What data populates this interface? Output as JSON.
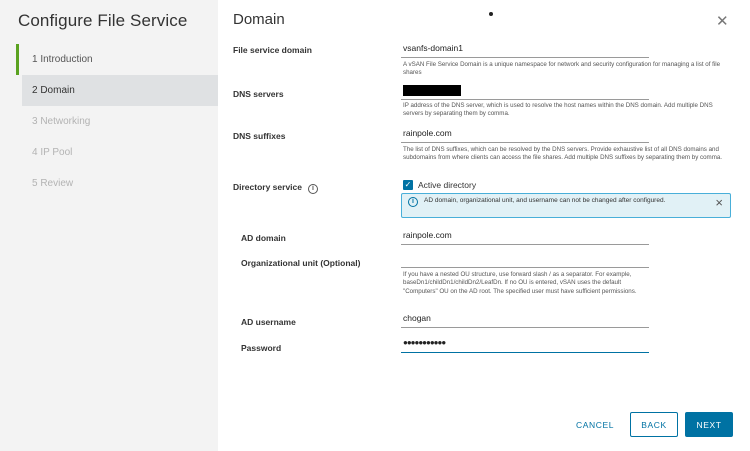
{
  "wizard": {
    "title": "Configure File Service",
    "steps": [
      {
        "label": "1  Introduction"
      },
      {
        "label": "2  Domain"
      },
      {
        "label": "3  Networking"
      },
      {
        "label": "4  IP Pool"
      },
      {
        "label": "5  Review"
      }
    ]
  },
  "page": {
    "title": "Domain"
  },
  "form": {
    "file_service_domain": {
      "label": "File service domain",
      "value": "vsanfs-domain1",
      "help": "A vSAN File Service Domain is a unique namespace for network and security configuration for managing a list of file shares"
    },
    "dns_servers": {
      "label": "DNS servers",
      "help": "IP address of the DNS server, which is used to resolve the host names within the DNS domain. Add multiple DNS servers by separating them by comma."
    },
    "dns_suffixes": {
      "label": "DNS suffixes",
      "value": "rainpole.com",
      "help": "The list of DNS suffixes, which can be resolved by the DNS servers. Provide exhaustive list of all DNS domains and subdomains from where clients can access the file shares. Add multiple DNS suffixes by separating them by comma."
    },
    "directory_service": {
      "label": "Directory service",
      "checkbox_label": "Active directory",
      "checked": true,
      "alert": "AD domain, organizational unit, and username can not be changed after configured."
    },
    "ad_domain": {
      "label": "AD domain",
      "value": "rainpole.com"
    },
    "organizational_unit": {
      "label": "Organizational unit (Optional)",
      "help": "If you have a nested OU structure, use forward slash / as a separator. For example, baseDn1/childDn1/childDn2/LeafDn. If no OU is entered, vSAN uses the default \"Computers\" OU on the AD root. The specified user must have sufficient permissions."
    },
    "ad_username": {
      "label": "AD username",
      "value": "chogan"
    },
    "password": {
      "label": "Password",
      "value": "●●●●●●●●●●●"
    }
  },
  "buttons": {
    "cancel": "CANCEL",
    "back": "BACK",
    "next": "NEXT"
  },
  "colors": {
    "accent": "#0072a3",
    "step_done": "#5aa220",
    "alert_bg": "#e1f1f6"
  }
}
